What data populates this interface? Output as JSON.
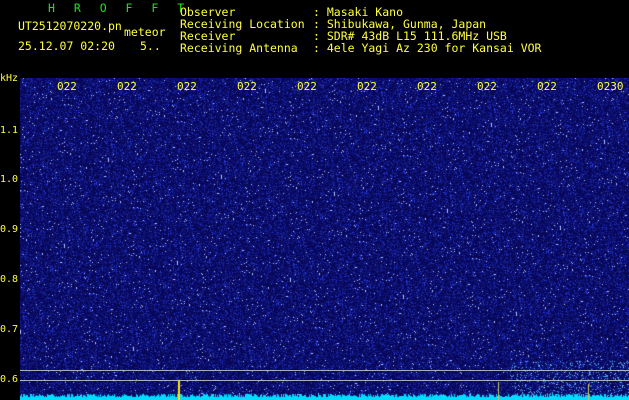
{
  "header": {
    "title": "H R O F F T",
    "filename": "UT2512070220.pn",
    "type": "meteor",
    "datetime": "25.12.07 02:20",
    "misc": "5..",
    "fields": [
      {
        "label": "Observer",
        "value": ": Masaki Kano"
      },
      {
        "label": "Receiving Location",
        "value": ": Shibukawa, Gunma, Japan"
      },
      {
        "label": "Receiver",
        "value": ": SDR# 43dB L15 111.6MHz USB"
      },
      {
        "label": "Receiving Antenna",
        "value": ": 4ele Yagi Az 230 for Kansai VOR"
      }
    ]
  },
  "axis": {
    "unit": "kHz",
    "y_ticks": [
      "1.1",
      "1.0",
      "0.9",
      "0.8",
      "0.7",
      "0.6"
    ],
    "x_ticks": [
      "022",
      "022",
      "022",
      "022",
      "022",
      "022",
      "022",
      "022",
      "022",
      "0230"
    ]
  },
  "colors": {
    "background": "#0a0a5a",
    "noise": "#3c50ff",
    "text": "#ffff3c",
    "title": "#19e619",
    "baseline": "#00dcff"
  }
}
